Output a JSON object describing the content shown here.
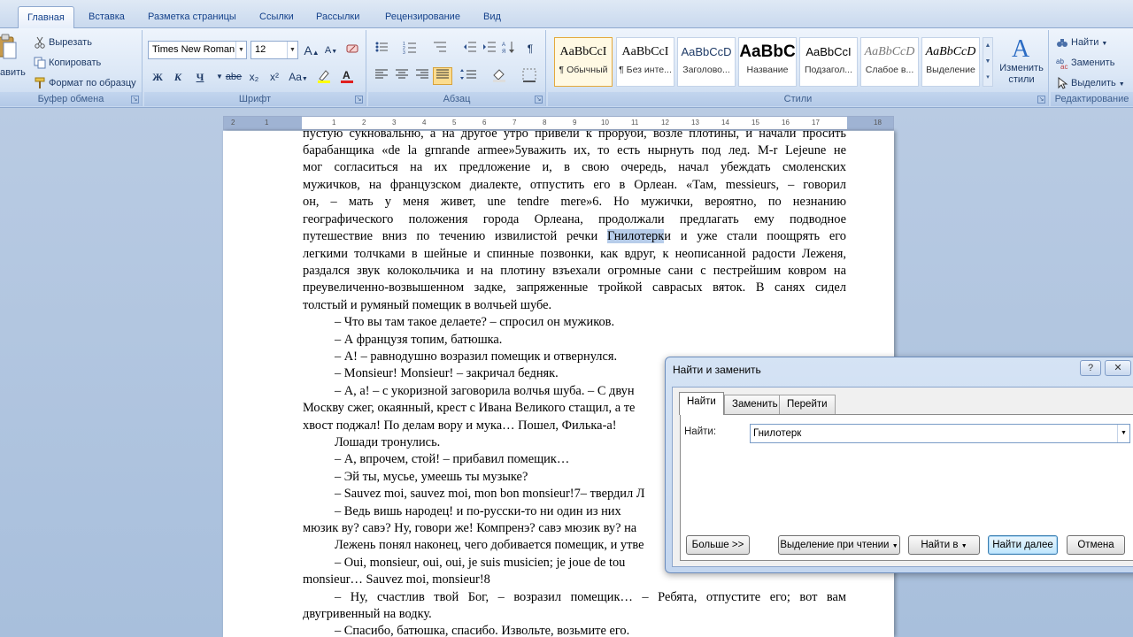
{
  "tabs": [
    "Главная",
    "Вставка",
    "Разметка страницы",
    "Ссылки",
    "Рассылки",
    "Рецензирование",
    "Вид"
  ],
  "clipboard": {
    "paste_label": "авить",
    "cut": "Вырезать",
    "copy": "Копировать",
    "format_painter": "Формат по образцу",
    "group_label": "Буфер обмена"
  },
  "font": {
    "name": "Times New Roman",
    "size": "12",
    "bold": "Ж",
    "italic": "К",
    "underline": "Ч",
    "strike": "abe",
    "subscript": "x₂",
    "superscript": "x²",
    "case": "Aa",
    "grow": "A",
    "shrink": "A",
    "group_label": "Шрифт"
  },
  "paragraph": {
    "group_label": "Абзац"
  },
  "styles": {
    "items": [
      {
        "sample": "AaBbCcI",
        "name": "¶ Обычный"
      },
      {
        "sample": "AaBbCcI",
        "name": "¶ Без инте..."
      },
      {
        "sample": "AaBbCcD",
        "name": "Заголово..."
      },
      {
        "sample": "AaBbC",
        "name": "Название"
      },
      {
        "sample": "AaBbCcI",
        "name": "Подзагол..."
      },
      {
        "sample": "AaBbCcD",
        "name": "Слабое в..."
      },
      {
        "sample": "AaBbCcD",
        "name": "Выделение"
      }
    ],
    "change_line1": "Изменить",
    "change_line2": "стили",
    "group_label": "Стили"
  },
  "editing": {
    "find": "Найти",
    "replace": "Заменить",
    "select": "Выделить",
    "group_label": "Редактирование"
  },
  "ruler": {
    "ticks": [
      "2",
      "1",
      "1",
      "2",
      "3",
      "4",
      "5",
      "6",
      "7",
      "8",
      "9",
      "10",
      "11",
      "12",
      "13",
      "14",
      "15",
      "16",
      "17",
      "18"
    ]
  },
  "document": {
    "l01": "пустую сукновальню, а на другое утро привели к проруби, возле плотины, и начали просить",
    "l02": "барабанщика «de la grnrande armee»5уважить их, то есть нырнуть под лед. M-r Lejeune не",
    "l03": "мог согласиться на их предложение и, в свою очередь, начал убеждать смоленских",
    "l04": "мужичков, на французском диалекте, отпустить его в Орлеан. «Там, messieurs, – говорил",
    "l05": "он, – мать у меня живет, une tendre mere»6. Но мужички, вероятно, по незнанию",
    "l06": "географического положения города Орлеана, продолжали предлагать ему подводное",
    "l07a": "путешествие вниз по течению извилистой речки ",
    "l07b": "Гнилотерк",
    "l07c": "и и уже стали поощрять его",
    "l08": "легкими толчками в шейные и спинные позвонки, как вдруг, к неописанной радости Леженя,",
    "l09": "раздался звук колокольчика и на плотину взъехали огромные сани с пестрейшим ковром на",
    "l10": "преувеличенно-возвышенном задке, запряженные тройкой саврасых вяток. В санях сидел",
    "l11": "толстый и румяный помещик в волчьей шубе.",
    "l12": "– Что вы там такое делаете? – спросил он мужиков.",
    "l13": "– А французя топим, батюшка.",
    "l14": "– А! – равнодушно возразил помещик и отвернулся.",
    "l15": "– Monsieur! Monsieur! – закричал бедняк.",
    "l16": "– А, а! – с укоризной заговорила волчья шуба. – С двун",
    "l17": "Москву сжег, окаянный, крест с Ивана Великого стащил, а те",
    "l18": "хвост поджал! По делам вору и мука… Пошел, Филька-а!",
    "l19": "Лошади тронулись.",
    "l20": "– А, впрочем, стой! – прибавил помещик…",
    "l21": "– Эй ты, мусье, умеешь ты музыке?",
    "l22": "– Sauvez moi, sauvez moi, mon bon monsieur!7– твердил Л",
    "l23": "– Ведь вишь народец! и по-русски-то ни один из них",
    "l24": "мюзик ву? савэ? Ну, говори же! Компренэ? савэ мюзик ву? на",
    "l25": "Лежень понял наконец, чего добивается помещик, и утве",
    "l26": "– Oui, monsieur, oui, oui, je suis musicien; je joue de tou",
    "l27": "monsieur… Sauvez moi, monsieur!8",
    "l28": "– Ну, счастлив твой Бог, – возразил помещик… – Ребята, отпустите его; вот вам",
    "l29": "двугривенный на водку.",
    "l30": "– Спасибо, батюшка, спасибо. Извольте, возьмите его."
  },
  "dialog": {
    "title": "Найти и заменить",
    "help": "?",
    "tabs": [
      "Найти",
      "Заменить",
      "Перейти"
    ],
    "find_label": "Найти:",
    "find_value": "Гнилотерк",
    "more_button": "Больше >>",
    "reading_highlight": "Выделение при чтении",
    "find_in": "Найти в",
    "find_next": "Найти далее",
    "cancel": "Отмена"
  }
}
